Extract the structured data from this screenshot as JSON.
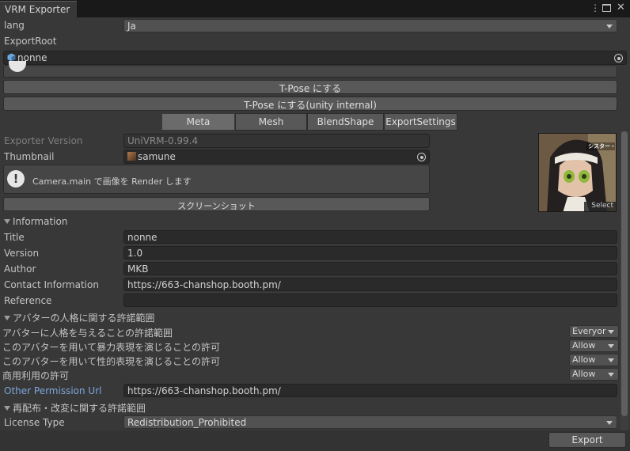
{
  "window": {
    "tab_title": "VRM Exporter",
    "menu_icon": "kebab-menu-icon",
    "maximize_icon": "maximize-icon",
    "close_icon": "close-icon"
  },
  "lang": {
    "label": "lang",
    "value": "Ja"
  },
  "export_root": {
    "label": "ExportRoot",
    "value": "nonne"
  },
  "buttons": {
    "tpose": "T-Pose にする",
    "tpose_internal": "T-Pose にする(unity internal)",
    "screenshot": "スクリーンショット",
    "export": "Export"
  },
  "tabs": [
    "Meta",
    "Mesh",
    "BlendShape",
    "ExportSettings"
  ],
  "active_tab": "Meta",
  "exporter_version": {
    "label": "Exporter Version",
    "value": "UniVRM-0.99.4"
  },
  "thumbnail": {
    "label": "Thumbnail",
    "value": "samune",
    "preview_select": "Select",
    "preview_overlay_text": "シスター・ノンネ"
  },
  "help_message": "Camera.main で画像を Render します",
  "information": {
    "header": "Information",
    "fields": [
      {
        "label": "Title",
        "value": "nonne"
      },
      {
        "label": "Version",
        "value": "1.0"
      },
      {
        "label": "Author",
        "value": "MKB"
      },
      {
        "label": "Contact Information",
        "value": "https://663-chanshop.booth.pm/"
      },
      {
        "label": "Reference",
        "value": ""
      }
    ]
  },
  "permission": {
    "header": "アバターの人格に関する許諾範囲",
    "rows": [
      {
        "label": "アバターに人格を与えることの許諾範囲",
        "value": "Everyor"
      },
      {
        "label": "このアバターを用いて暴力表現を演じることの許可",
        "value": "Allow"
      },
      {
        "label": "このアバターを用いて性的表現を演じることの許可",
        "value": "Allow"
      },
      {
        "label": "商用利用の許可",
        "value": "Allow"
      }
    ],
    "other_url_label": "Other Permission Url",
    "other_url_value": "https://663-chanshop.booth.pm/"
  },
  "redistribution": {
    "header": "再配布・改変に関する許諾範囲",
    "license_label": "License Type",
    "license_value": "Redistribution_Prohibited"
  },
  "colors": {
    "background": "#383838",
    "field": "#2a2a2a",
    "link_label": "#7ea6db"
  }
}
